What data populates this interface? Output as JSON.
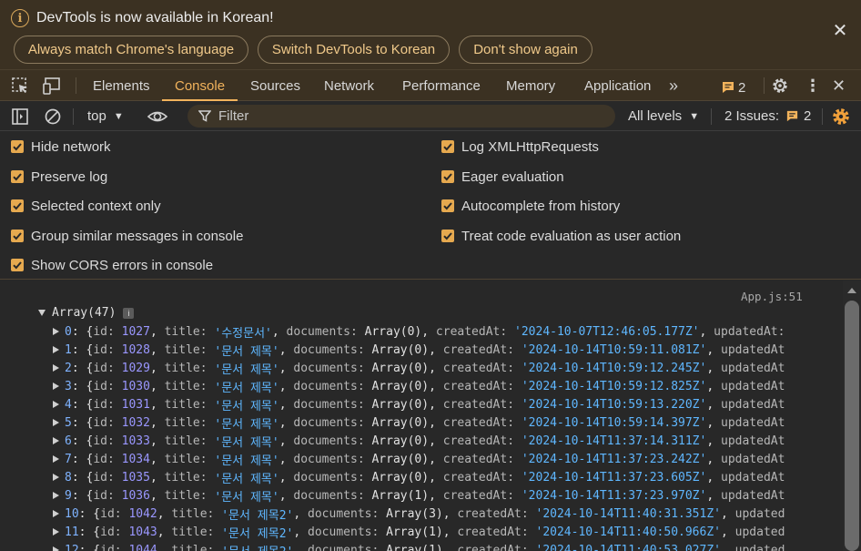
{
  "infobar": {
    "message": "DevTools is now available in Korean!",
    "buttons": [
      "Always match Chrome's language",
      "Switch DevTools to Korean",
      "Don't show again"
    ]
  },
  "tabs": {
    "items": [
      "Elements",
      "Console",
      "Sources",
      "Network",
      "Performance",
      "Memory",
      "Application"
    ],
    "active": "Console",
    "messages_count": "2"
  },
  "console_toolbar": {
    "context": "top",
    "filter_placeholder": "Filter",
    "levels": "All levels",
    "issues_label": "2 Issues:",
    "issues_count": "2"
  },
  "settings": {
    "left": [
      "Hide network",
      "Preserve log",
      "Selected context only",
      "Group similar messages in console",
      "Show CORS errors in console"
    ],
    "right": [
      "Log XMLHttpRequests",
      "Eager evaluation",
      "Autocomplete from history",
      "Treat code evaluation as user action"
    ]
  },
  "console": {
    "source": "App.js:51",
    "array_label": "Array(47)",
    "info_badge": "i",
    "rows": [
      {
        "idx": "0",
        "id": "1027",
        "title": "'수정문서'",
        "docs": "Array(0)",
        "created": "'2024-10-07T12:46:05.177Z'",
        "tail": "updatedAt:"
      },
      {
        "idx": "1",
        "id": "1028",
        "title": "'문서 제목'",
        "docs": "Array(0)",
        "created": "'2024-10-14T10:59:11.081Z'",
        "tail": "updatedAt"
      },
      {
        "idx": "2",
        "id": "1029",
        "title": "'문서 제목'",
        "docs": "Array(0)",
        "created": "'2024-10-14T10:59:12.245Z'",
        "tail": "updatedAt"
      },
      {
        "idx": "3",
        "id": "1030",
        "title": "'문서 제목'",
        "docs": "Array(0)",
        "created": "'2024-10-14T10:59:12.825Z'",
        "tail": "updatedAt"
      },
      {
        "idx": "4",
        "id": "1031",
        "title": "'문서 제목'",
        "docs": "Array(0)",
        "created": "'2024-10-14T10:59:13.220Z'",
        "tail": "updatedAt"
      },
      {
        "idx": "5",
        "id": "1032",
        "title": "'문서 제목'",
        "docs": "Array(0)",
        "created": "'2024-10-14T10:59:14.397Z'",
        "tail": "updatedAt"
      },
      {
        "idx": "6",
        "id": "1033",
        "title": "'문서 제목'",
        "docs": "Array(0)",
        "created": "'2024-10-14T11:37:14.311Z'",
        "tail": "updatedAt"
      },
      {
        "idx": "7",
        "id": "1034",
        "title": "'문서 제목'",
        "docs": "Array(0)",
        "created": "'2024-10-14T11:37:23.242Z'",
        "tail": "updatedAt"
      },
      {
        "idx": "8",
        "id": "1035",
        "title": "'문서 제목'",
        "docs": "Array(0)",
        "created": "'2024-10-14T11:37:23.605Z'",
        "tail": "updatedAt"
      },
      {
        "idx": "9",
        "id": "1036",
        "title": "'문서 제목'",
        "docs": "Array(1)",
        "created": "'2024-10-14T11:37:23.970Z'",
        "tail": "updatedAt"
      },
      {
        "idx": "10",
        "id": "1042",
        "title": "'문서 제목2'",
        "docs": "Array(3)",
        "created": "'2024-10-14T11:40:31.351Z'",
        "tail": "updated"
      },
      {
        "idx": "11",
        "id": "1043",
        "title": "'문서 제목2'",
        "docs": "Array(1)",
        "created": "'2024-10-14T11:40:50.966Z'",
        "tail": "updated"
      },
      {
        "idx": "12",
        "id": "1044",
        "title": "'문서 제목2'",
        "docs": "Array(1)",
        "created": "'2024-10-14T11:40:53.027Z'",
        "tail": "updated"
      }
    ]
  }
}
